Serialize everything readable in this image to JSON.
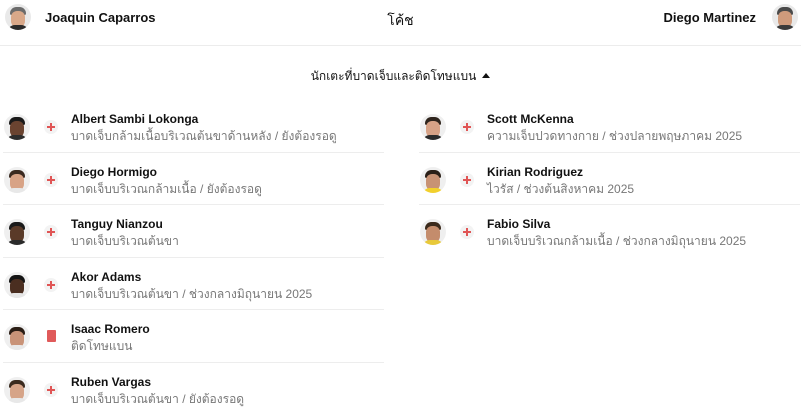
{
  "coaches": {
    "home": {
      "name": "Joaquin Caparros",
      "avatar_icon": "coach-avatar-icon"
    },
    "title": "โค้ช",
    "away": {
      "name": "Diego Martinez",
      "avatar_icon": "coach-avatar-icon"
    }
  },
  "section": {
    "title": "นักเตะที่บาดเจ็บและติดโทษแบน",
    "toggle_icon": "caret-up-icon"
  },
  "home_players": [
    {
      "name": "Albert Sambi Lokonga",
      "reason": "บาดเจ็บกล้ามเนื้อบริเวณต้นขาด้านหลัง / ยังต้องรอดู",
      "status_icon": "injury-cross-icon"
    },
    {
      "name": "Diego Hormigo",
      "reason": "บาดเจ็บบริเวณกล้ามเนื้อ / ยังต้องรอดู",
      "status_icon": "injury-cross-icon"
    },
    {
      "name": "Tanguy Nianzou",
      "reason": "บาดเจ็บบริเวณต้นขา",
      "status_icon": "injury-cross-icon"
    },
    {
      "name": "Akor Adams",
      "reason": "บาดเจ็บบริเวณต้นขา / ช่วงกลางมิถุนายน 2025",
      "status_icon": "injury-cross-icon"
    },
    {
      "name": "Isaac Romero",
      "reason": "ติดโทษแบน",
      "status_icon": "red-card-icon"
    },
    {
      "name": "Ruben Vargas",
      "reason": "บาดเจ็บบริเวณต้นขา / ยังต้องรอดู",
      "status_icon": "injury-cross-icon"
    }
  ],
  "away_players": [
    {
      "name": "Scott McKenna",
      "reason": "ความเจ็บปวดทางกาย / ช่วงปลายพฤษภาคม 2025",
      "status_icon": "injury-cross-icon"
    },
    {
      "name": "Kirian Rodriguez",
      "reason": "ไวรัส / ช่วงต้นสิงหาคม 2025",
      "status_icon": "injury-cross-icon"
    },
    {
      "name": "Fabio Silva",
      "reason": "บาดเจ็บบริเวณกล้ามเนื้อ / ช่วงกลางมิถุนายน 2025",
      "status_icon": "injury-cross-icon"
    }
  ],
  "colors": {
    "injury": "#e05555",
    "red_card": "#e05a5a",
    "muted_text": "#777777",
    "divider": "#ededed"
  }
}
